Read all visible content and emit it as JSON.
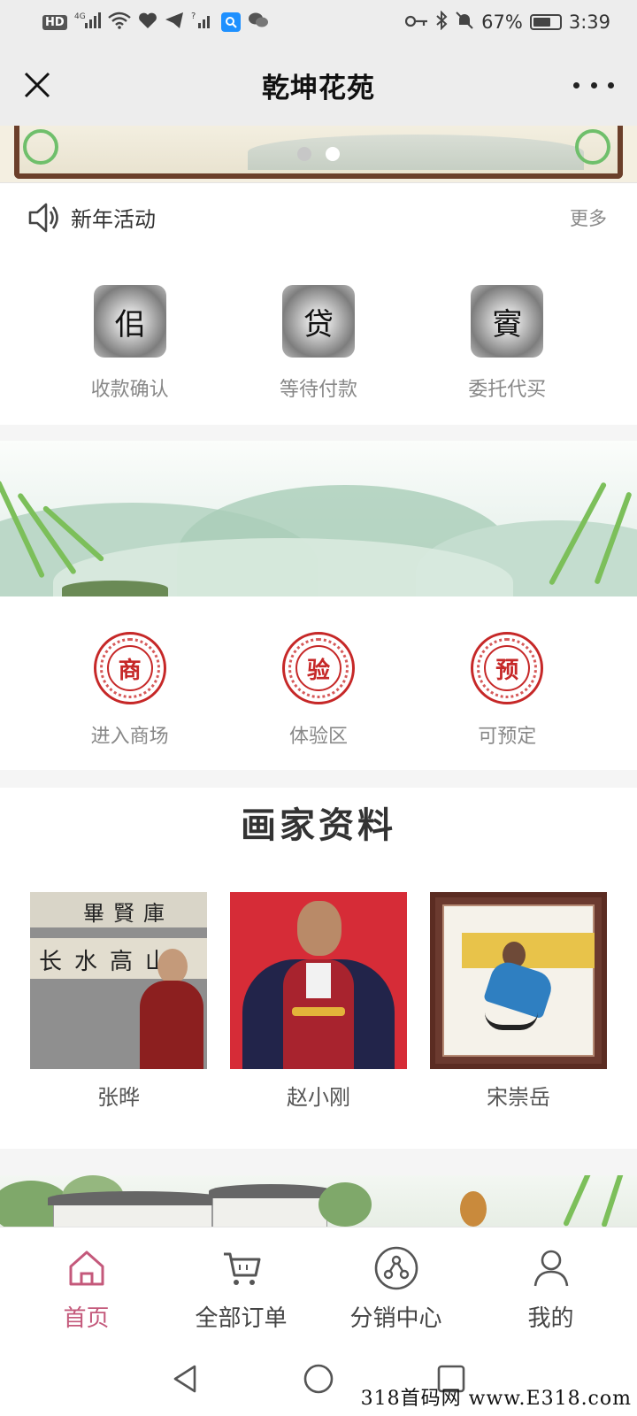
{
  "status_bar": {
    "left_badges": [
      "HD",
      "4G",
      "?"
    ],
    "battery": "67%",
    "battery_level": 0.67,
    "time": "3:39",
    "icons": [
      "hd-icon",
      "signal-icon",
      "wifi-icon",
      "heart-icon",
      "telegram-icon",
      "search-app-icon",
      "wechat-icon",
      "key-icon",
      "bluetooth-icon",
      "mute-bell-icon",
      "battery-icon"
    ]
  },
  "header": {
    "title": "乾坤花苑",
    "close_icon": "close-icon",
    "more_icon": "more-icon"
  },
  "banner": {
    "slide_count": 2,
    "active_slide": 2
  },
  "notice": {
    "text": "新年活动",
    "more": "更多",
    "icon": "speaker-icon"
  },
  "quick_actions": [
    {
      "label": "收款确认",
      "glyph": "佀"
    },
    {
      "label": "等待付款",
      "glyph": "贷"
    },
    {
      "label": "委托代买",
      "glyph": "賨"
    }
  ],
  "entries": [
    {
      "label": "进入商场",
      "glyph": "商"
    },
    {
      "label": "体验区",
      "glyph": "验"
    },
    {
      "label": "可预定",
      "glyph": "预"
    }
  ],
  "painters_section": {
    "title": "画家资料",
    "painters": [
      {
        "name": "张晔",
        "calligraphy_line1": "畢賢庫",
        "calligraphy_line2": "长水高山"
      },
      {
        "name": "赵小刚"
      },
      {
        "name": "宋崇岳"
      }
    ]
  },
  "tab_bar": [
    {
      "label": "首页",
      "icon": "home-icon",
      "active": true
    },
    {
      "label": "全部订单",
      "icon": "cart-icon",
      "active": false
    },
    {
      "label": "分销中心",
      "icon": "network-icon",
      "active": false
    },
    {
      "label": "我的",
      "icon": "user-icon",
      "active": false
    }
  ],
  "watermark": "318首码网 www.E318.com",
  "colors": {
    "accent": "#c4597b",
    "seal_red": "#c62828",
    "header_bg": "#ededed"
  }
}
